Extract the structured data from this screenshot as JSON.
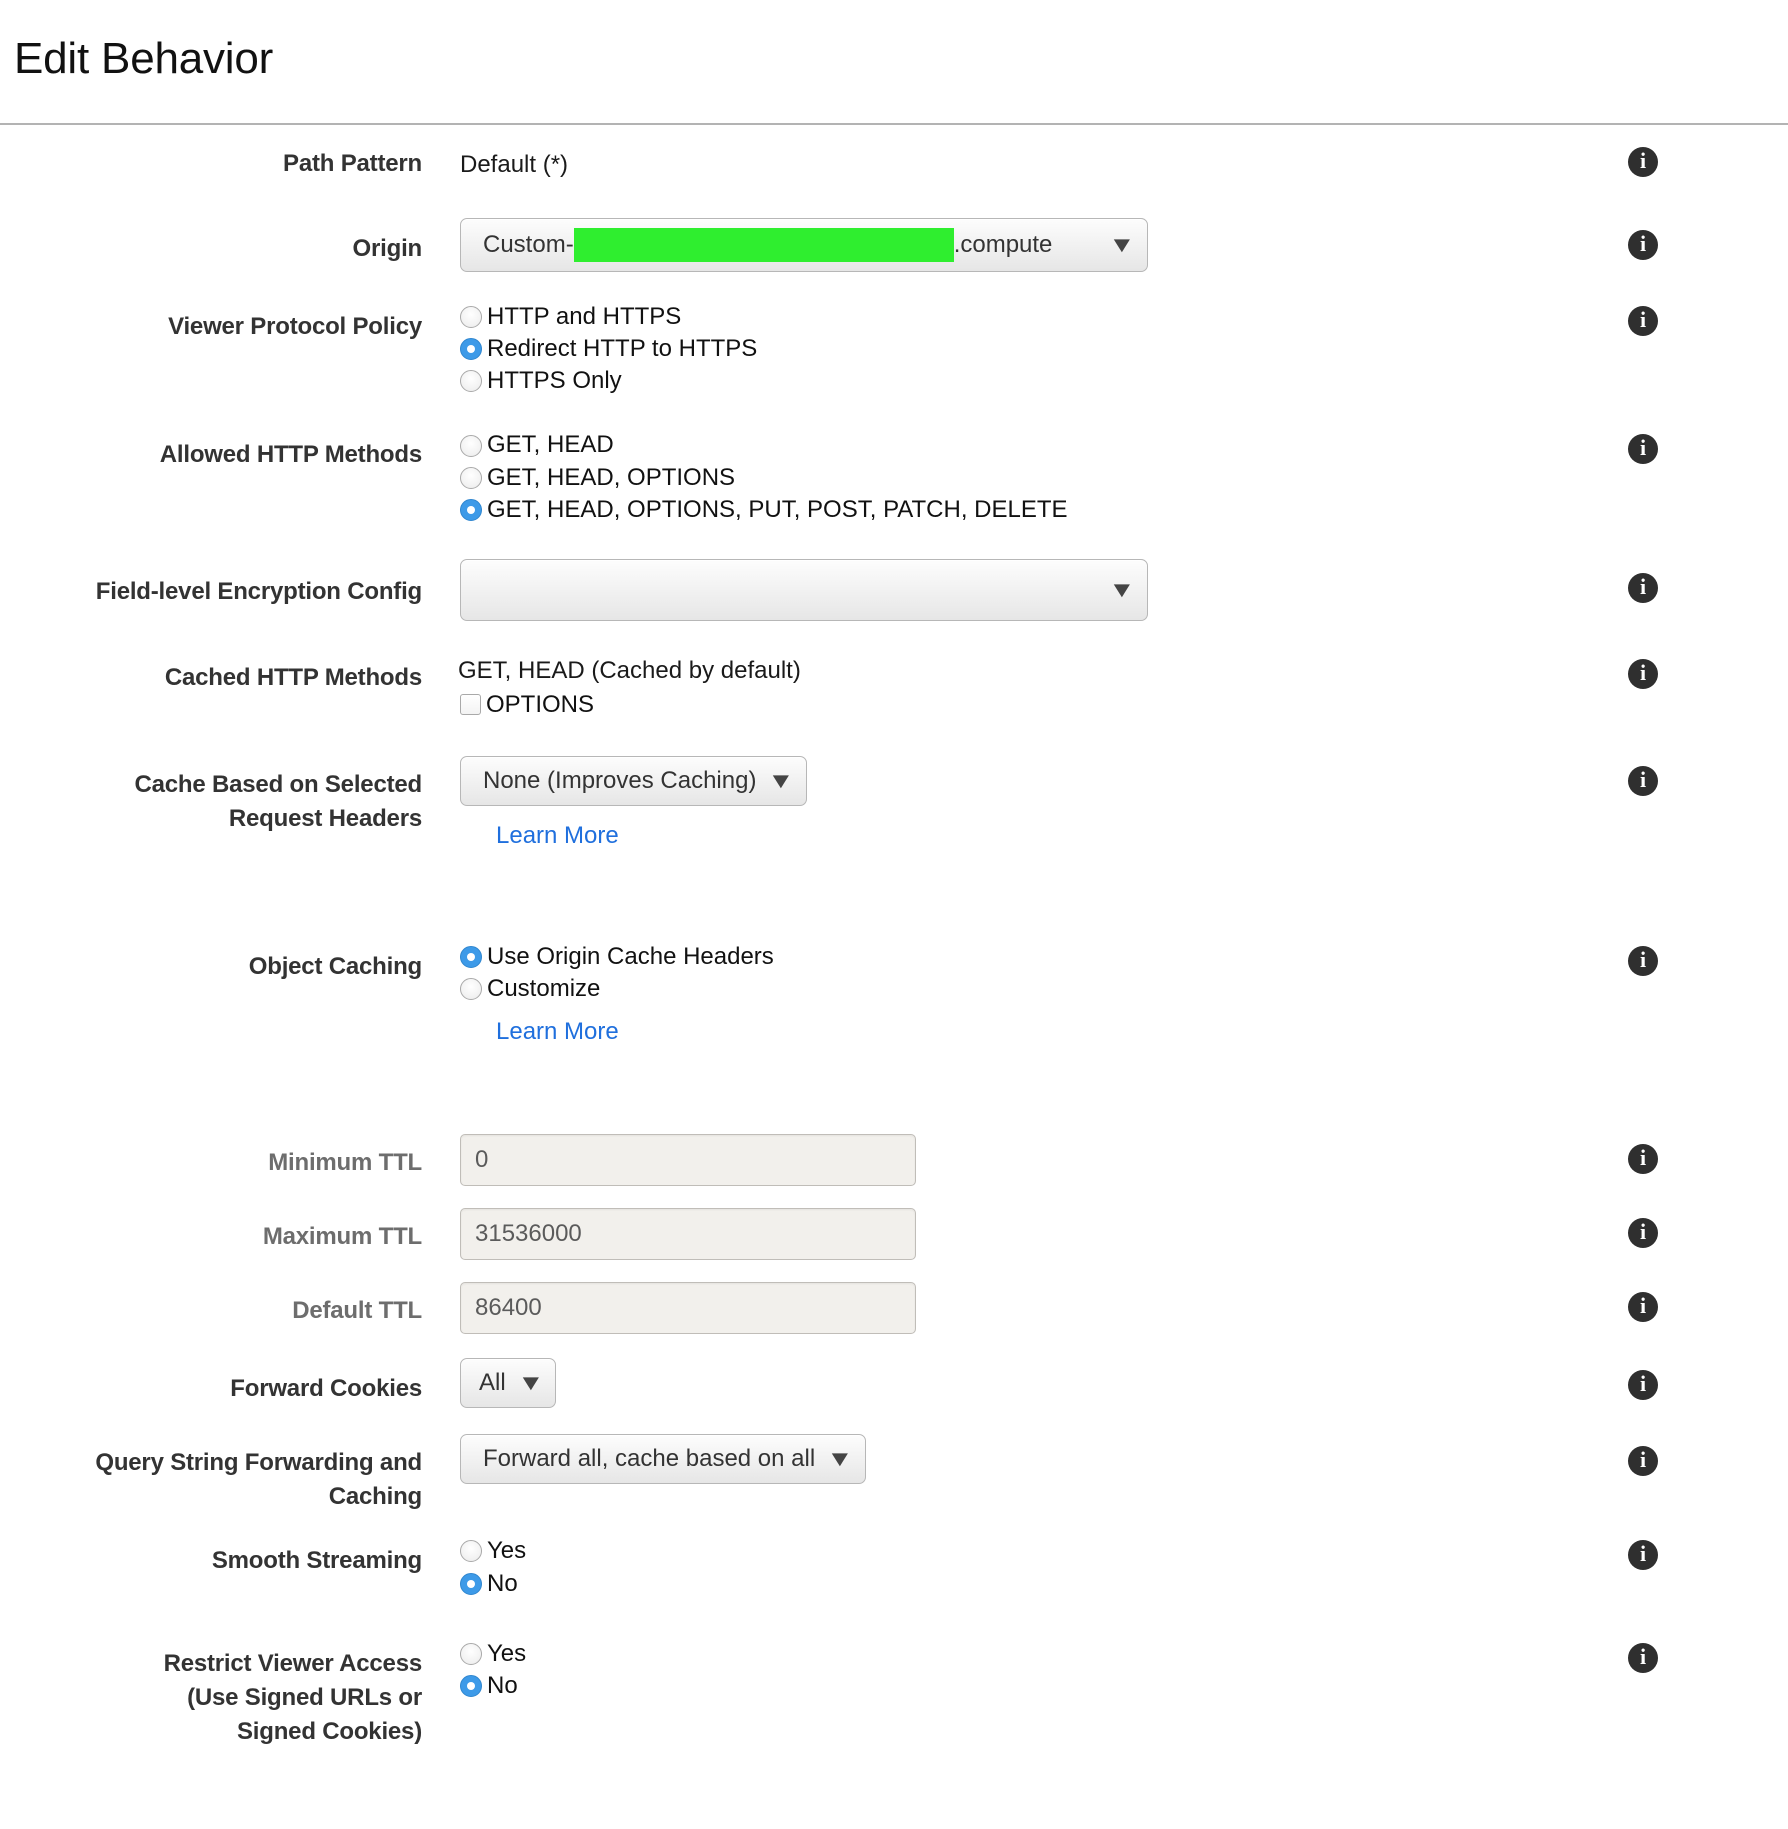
{
  "page": {
    "title": "Edit Behavior"
  },
  "icons": {
    "info": "i",
    "caret_down": "⌄",
    "info_icon_name": "info-icon"
  },
  "colors": {
    "accent_blue": "#3d9ae8",
    "link_blue": "#1f6fdd",
    "redaction_green": "#2fee2f",
    "info_badge": "#2f2f2f"
  },
  "fields": {
    "path_pattern": {
      "label": "Path Pattern",
      "value": "Default (*)"
    },
    "origin": {
      "label": "Origin",
      "prefix": "Custom-",
      "redacted": true,
      "suffix": ".compute",
      "caret": "⌄"
    },
    "viewer_protocol_policy": {
      "label": "Viewer Protocol Policy",
      "options": [
        {
          "label": "HTTP and HTTPS",
          "checked": false
        },
        {
          "label": "Redirect HTTP to HTTPS",
          "checked": true
        },
        {
          "label": "HTTPS Only",
          "checked": false
        }
      ]
    },
    "allowed_http_methods": {
      "label": "Allowed HTTP Methods",
      "options": [
        {
          "label": "GET, HEAD",
          "checked": false
        },
        {
          "label": "GET, HEAD, OPTIONS",
          "checked": false
        },
        {
          "label": "GET, HEAD, OPTIONS, PUT, POST, PATCH, DELETE",
          "checked": true
        }
      ]
    },
    "field_level_encryption": {
      "label": "Field-level Encryption Config",
      "value": "",
      "caret": "⌄"
    },
    "cached_http_methods": {
      "label": "Cached HTTP Methods",
      "default_text": "GET, HEAD (Cached by default)",
      "options": [
        {
          "label": "OPTIONS",
          "checked": false
        }
      ]
    },
    "cache_based_on_headers": {
      "label_line1": "Cache Based on Selected",
      "label_line2": "Request Headers",
      "value": "None (Improves Caching)",
      "caret": "⌄",
      "learn_more": "Learn More"
    },
    "object_caching": {
      "label": "Object Caching",
      "options": [
        {
          "label": "Use Origin Cache Headers",
          "checked": true
        },
        {
          "label": "Customize",
          "checked": false
        }
      ],
      "learn_more": "Learn More"
    },
    "minimum_ttl": {
      "label": "Minimum TTL",
      "value": "0",
      "disabled": true
    },
    "maximum_ttl": {
      "label": "Maximum TTL",
      "value": "31536000",
      "disabled": true
    },
    "default_ttl": {
      "label": "Default TTL",
      "value": "86400",
      "disabled": true
    },
    "forward_cookies": {
      "label": "Forward Cookies",
      "value": "All",
      "caret": "⌄"
    },
    "query_string_forwarding": {
      "label_line1": "Query String Forwarding and",
      "label_line2": "Caching",
      "value": "Forward all, cache based on all",
      "caret": "⌄"
    },
    "smooth_streaming": {
      "label": "Smooth Streaming",
      "options": [
        {
          "label": "Yes",
          "checked": false
        },
        {
          "label": "No",
          "checked": true
        }
      ]
    },
    "restrict_viewer_access": {
      "label_line1": "Restrict Viewer Access",
      "label_line2": "(Use Signed URLs or",
      "label_line3": "Signed Cookies)",
      "options": [
        {
          "label": "Yes",
          "checked": false
        },
        {
          "label": "No",
          "checked": true
        }
      ]
    }
  }
}
